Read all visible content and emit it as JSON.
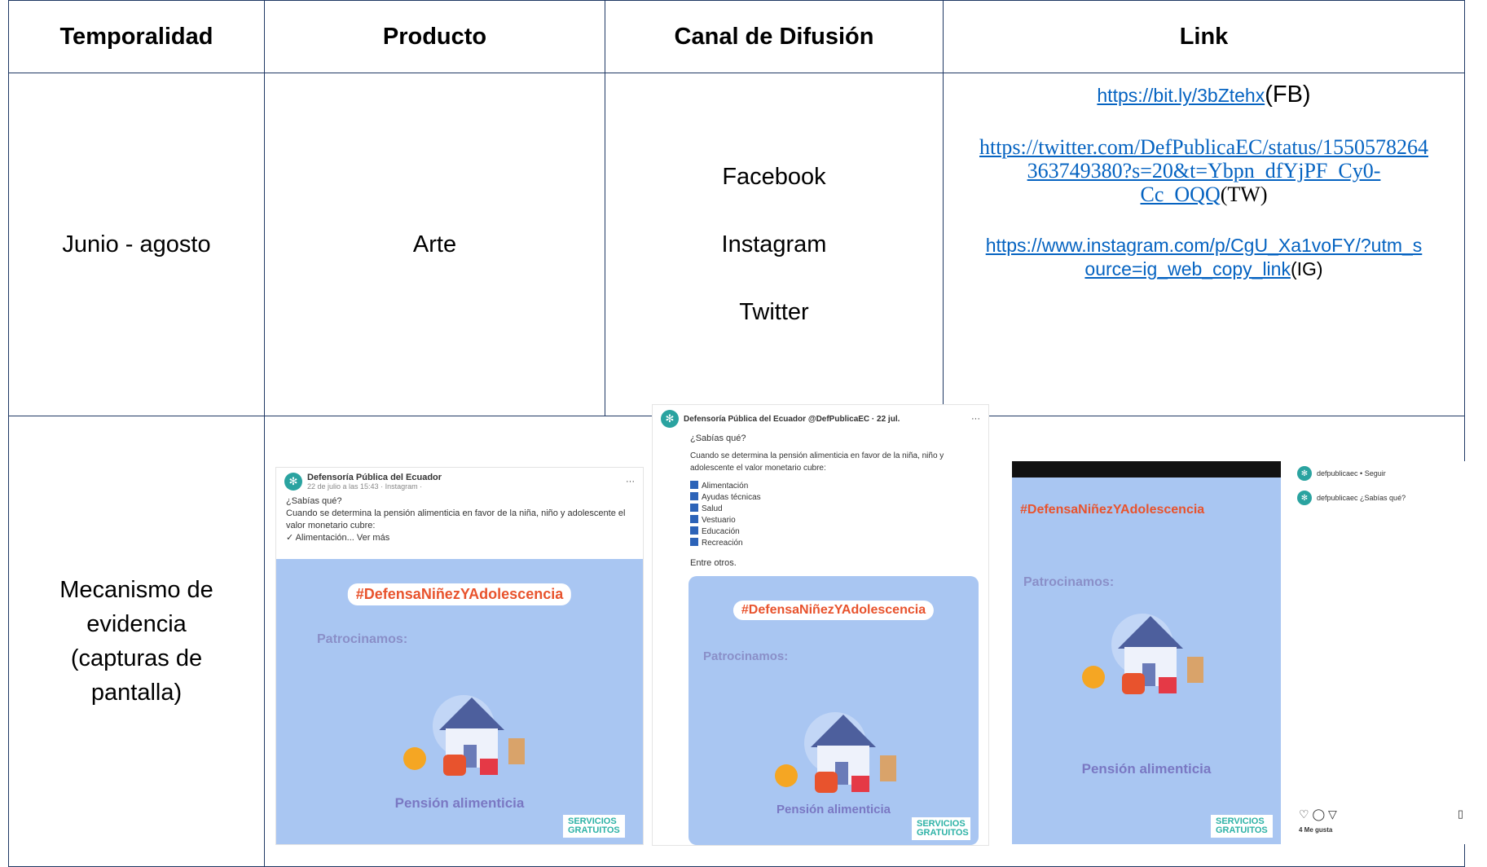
{
  "headers": [
    "Temporalidad",
    "Producto",
    "Canal de Difusión",
    "Link"
  ],
  "row1": {
    "temporalidad": "Junio - agosto",
    "producto": "Arte",
    "canales": [
      "Facebook",
      "Instagram",
      "Twitter"
    ],
    "links": {
      "fb_url": "https://bit.ly/3bZtehx",
      "fb_tag": "(FB)",
      "tw_url": "https://twitter.com/DefPublicaEC/status/1550578264363749380?s=20&t=Ybpn_dfYjPF_Cy0-Cc_OQQ",
      "tw_line1": "https://twitter.com/DefPublicaEC/status/1550578264",
      "tw_line2": "363749380?s=20&t=Ybpn_dfYjPF_Cy0-",
      "tw_line3": "Cc_OQQ",
      "tw_tag": "(TW)",
      "ig_url": "https://www.instagram.com/p/CgU_Xa1voFY/?utm_source=ig_web_copy_link",
      "ig_line1": "https://www.instagram.com/p/CgU_Xa1voFY/?utm_s",
      "ig_line2": "ource=ig_web_copy_link",
      "ig_tag": "(IG)"
    }
  },
  "row2": {
    "label": "Mecanismo de evidencia (capturas de pantalla)",
    "shot_fb": {
      "account": "Defensoría Pública del Ecuador",
      "meta": "22 de julio a las 15:43 · Instagram ·",
      "q": "¿Sabías qué?",
      "body": "Cuando se determina la pensión alimenticia en favor de la niña, niño y adolescente el valor monetario cubre:",
      "more": "✓ Alimentación... Ver más"
    },
    "shot_tw": {
      "account": "Defensoría Pública del Ecuador @DefPublicaEC · 22 jul.",
      "q": "¿Sabías qué?",
      "body": "Cuando se determina la pensión alimenticia en favor de la niña, niño y adolescente el valor monetario cubre:",
      "items": [
        "Alimentación",
        "Ayudas técnicas",
        "Salud",
        "Vestuario",
        "Educación",
        "Recreación"
      ],
      "end": "Entre otros."
    },
    "shot_ig": {
      "account": "defpublicaec • Seguir",
      "caption": "defpublicaec ¿Sabías qué?",
      "likes": "4 Me gusta"
    },
    "art": {
      "hashtag": "#DefensaNiñezYAdolescencia",
      "patrocinamos": "Patrocinamos:",
      "pension": "Pensión alimenticia",
      "servicios": "SERVICIOS GRATUITOS"
    }
  }
}
